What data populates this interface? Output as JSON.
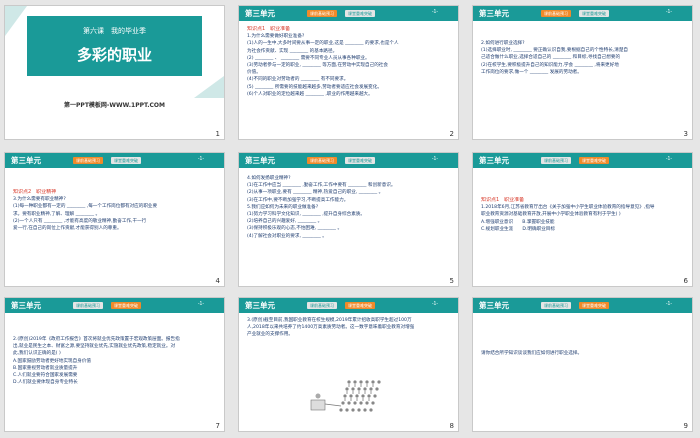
{
  "colors": {
    "header": "#1a9a98",
    "tab_active": "#f08a2a",
    "section_label": "#d83a2b",
    "text": "#1d3b6e"
  },
  "header": {
    "unit": "第三单元",
    "tab1": "课前基础预习",
    "tab2": "课堂重难突破",
    "page": "-1-"
  },
  "slides": [
    {
      "number": "1",
      "lesson": "第六课　我的毕业季",
      "title": "多彩的职业",
      "site": "第一PPT模板网-WWW.1PPT.COM"
    },
    {
      "number": "2",
      "section": "知识点1　职业准备",
      "lines": [
        "1.为什么需要做好职业准备?",
        "(1)人的一生中,大多时间要从事一定的职业,这是 ________ 的要求,也是个人",
        "为社会作贡献、实现 ________ 的基本路径。",
        "(2) ________ 、 ________ 需要不同专业人员从事各种职业。",
        "(3)劳动者参与一定的职业, ________ 等方面,在劳动中实现自己的社会",
        "价值。",
        "(4)不同的职业对劳动者的 ________ 有不同要求。",
        "(5) ________ 所需要的技能越来越多,劳动者要适应社会发展变化。",
        "(6)个人对职业的定位越来越 ________ ,职业的作用越来越大。"
      ]
    },
    {
      "number": "3",
      "lines": [
        "2.如何进行职业选择?",
        "(1)选择职业时, ________ 要正确认识自我,要根据自己的个性特长,清楚自",
        "己适合做什么职业,选择合适自己的 ________ 和目标,寻找自己想要的",
        "(2)在校学生,要积极提升自己的知识能力,学会 ________ ,将来更好地",
        "工作岗位的要求,做一个 ________ 发展的劳动者。"
      ]
    },
    {
      "number": "4",
      "section": "知识点2　职业精神",
      "lines": [
        "3.为什么需要有职业精神?",
        "(1)每一种职业都有一定的 ________ ,每一个工作岗位都有对应的职业要",
        "求。要有职业精神,了解、理解 ________ 。",
        "(2)一个人只有 ________ ,才能有高度的敬业精神,勤奋工作,干一行",
        "爱一行,在自己的岗位上作贡献,才能获得别人的尊重。"
      ]
    },
    {
      "number": "5",
      "lines": [
        "4.如何发扬职业精神?",
        "(1)在工作中应当 ________ ,勤奋工作,工作中要有 ________ 和创新意识。",
        "(2)从事一项职业,要有 ________ 精神,热爱自己的职业, ________ 。",
        "(3)在工作中,要不断加强学习,不断提高工作能力。",
        "5.我们应如何为未来的职业做准备?",
        "(1)努力学习科学文化知识, ________ ,提升自身综合素质。",
        "(2)培养自己的兴趣爱好, ________ 。",
        "(3)保持积极乐观的心态,不怕困难, ________ 。",
        "(4)了解社会对职业的要求, ________ 。"
      ]
    },
    {
      "number": "6",
      "section": "知识点1　职业准备",
      "lines": [
        "1.2018年6月,江苏省教育厅出台《关于加强中小学生职业体验教育的指导意见》,指导",
        "职业教育资源对基础教育开放,开展中小学职业体验教育有利于学生( )",
        "A.增强职业意识　　B.掌握职业技能",
        "C.规划职业生涯　　D.明确职业目标"
      ]
    },
    {
      "number": "7",
      "lines": [
        "2.(原创)2019年《政府工作报告》首次将就业优先政策置于宏观政策层面。报告指",
        "出,就业是民生之本、财富之源,要坚持就业优先,实施就业优先政策,稳定就业。对",
        "此,我们认识正确的是( )",
        "A.就业优先政策有利于保障和改善民生",
        "B.国家鼓励劳动者自主择业和自主创业",
        "C.劳动者要转变就业观念,树立职业平等观",
        "D.稳定就业是政府的重要职责",
        "A.国家鼓励劳动者更好地实现自身价值",
        "B.国家重视劳动者就业质量提升",
        "C.人们就业要符合国家发展需要",
        "D.人们就业要体现自身专业特长"
      ]
    },
    {
      "number": "8",
      "lines": [
        "3.(原创)截至目前,我国职业教育在校生规模,2019年累计招收高职学生超过100万",
        "人,2018年以来共培养了约1400万高素质劳动者。这一数字意味着职业教育对增强",
        "产业就业的支撑作用。"
      ]
    },
    {
      "number": "9",
      "lines": [
        "请你结合所学知识谈谈我们应如何进行职业选择。"
      ]
    }
  ]
}
